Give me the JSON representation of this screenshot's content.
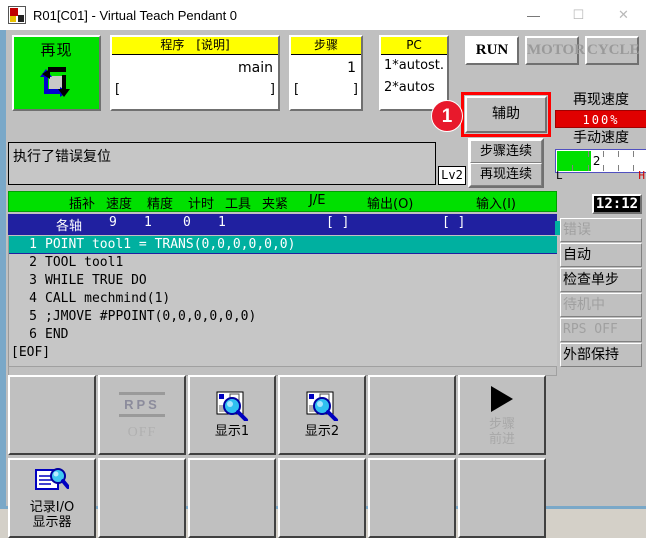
{
  "window": {
    "title": "R01[C01] - Virtual Teach Pendant 0",
    "app_icon": "robot-icon",
    "controls": {
      "minimize": "—",
      "maximize": "☐",
      "close": "✕"
    }
  },
  "top": {
    "mode_button": {
      "label": "再现",
      "icon": "cycle-arrows-icon",
      "color": "#00e000"
    },
    "program_panel": {
      "header": "程序　[说明]",
      "value": "main",
      "bracket_left": "[",
      "bracket_right": "]"
    },
    "step_panel": {
      "header": "步骤",
      "value": "1",
      "bracket_left": "[",
      "bracket_right": "]"
    },
    "pc_panel": {
      "header": "PC",
      "line1": "1*autost.",
      "line2": "2*autos"
    },
    "state_buttons": [
      {
        "label": "RUN",
        "active": true
      },
      {
        "label": "MOTOR",
        "active": false
      },
      {
        "label": "CYCLE",
        "active": false
      }
    ],
    "aux_button": {
      "label": "辅助",
      "focus_color": "#ff0000"
    },
    "badge": {
      "value": "1",
      "color": "#e8192c"
    },
    "replay_speed": {
      "label": "再现速度",
      "value": "100%",
      "color": "#e00000"
    },
    "manual_speed": {
      "label": "手动速度",
      "value": "2",
      "low": "L",
      "high": "H",
      "fill_percent": 38,
      "fill_color": "#00e000"
    }
  },
  "message": {
    "text": "执行了错误复位",
    "level": "Lv2"
  },
  "continuous_buttons": [
    {
      "label": "步骤连续"
    },
    {
      "label": "再现连续"
    }
  ],
  "clock": "12:12",
  "table": {
    "headers": [
      "插补",
      "速度",
      "精度",
      "计时",
      "工具",
      "夹紧",
      "J/E",
      "输出(O)",
      "输入(I)"
    ],
    "row": {
      "interp": "各轴",
      "speed": "9",
      "accuracy": "1",
      "timer": "0",
      "tool": "1",
      "clamp": "",
      "je": "",
      "output": "[                    ]",
      "input": "[                    ]"
    }
  },
  "code": {
    "lines": [
      {
        "num": "1",
        "text": "POINT tool1 = TRANS(0,0,0,0,0,0)",
        "selected": true
      },
      {
        "num": "2",
        "text": "TOOL tool1",
        "selected": false
      },
      {
        "num": "3",
        "text": "WHILE TRUE DO",
        "selected": false
      },
      {
        "num": "4",
        "text": "CALL mechmind(1)",
        "selected": false
      },
      {
        "num": "5",
        "text": ";JMOVE #PPOINT(0,0,0,0,0,0)",
        "selected": false
      },
      {
        "num": "6",
        "text": "END",
        "selected": false
      }
    ],
    "eof": "[EOF]",
    "selection_color": "#00b0a0"
  },
  "status_items": [
    {
      "label": "错误",
      "dim": true,
      "chip": "#00c000"
    },
    {
      "label": "自动",
      "dim": false,
      "chip": "#2020a0"
    },
    {
      "label": "检查单步",
      "dim": false,
      "chip": "#00b0a0"
    },
    {
      "label": "待机中",
      "dim": true,
      "chip": ""
    },
    {
      "label": "RPS OFF",
      "dim": true,
      "chip": ""
    },
    {
      "label": "外部保持",
      "dim": false,
      "chip": ""
    }
  ],
  "function_buttons_row1": [
    {
      "label": "",
      "icon": "",
      "dim": false
    },
    {
      "label": "OFF",
      "icon": "rps-icon",
      "dim": true,
      "top_text": "RPS"
    },
    {
      "label": "显示1",
      "icon": "magnifier-window-icon",
      "dim": false
    },
    {
      "label": "显示2",
      "icon": "magnifier-window-icon",
      "dim": false
    },
    {
      "label": "",
      "icon": "",
      "dim": false
    },
    {
      "label": "步骤\n前进",
      "label_line1": "步骤",
      "label_line2": "前进",
      "icon": "play-triangle-icon",
      "dim": true
    }
  ],
  "function_buttons_row2": [
    {
      "label_line1": "记录I/O",
      "label_line2": "显示器",
      "icon": "document-magnifier-icon",
      "dim": false
    },
    {
      "label_line1": "",
      "label_line2": "",
      "icon": "",
      "dim": false
    },
    {
      "label_line1": "",
      "label_line2": "",
      "icon": "",
      "dim": false
    },
    {
      "label_line1": "",
      "label_line2": "",
      "icon": "",
      "dim": false
    },
    {
      "label_line1": "",
      "label_line2": "",
      "icon": "",
      "dim": false
    },
    {
      "label_line1": "",
      "label_line2": "",
      "icon": "",
      "dim": false
    }
  ]
}
